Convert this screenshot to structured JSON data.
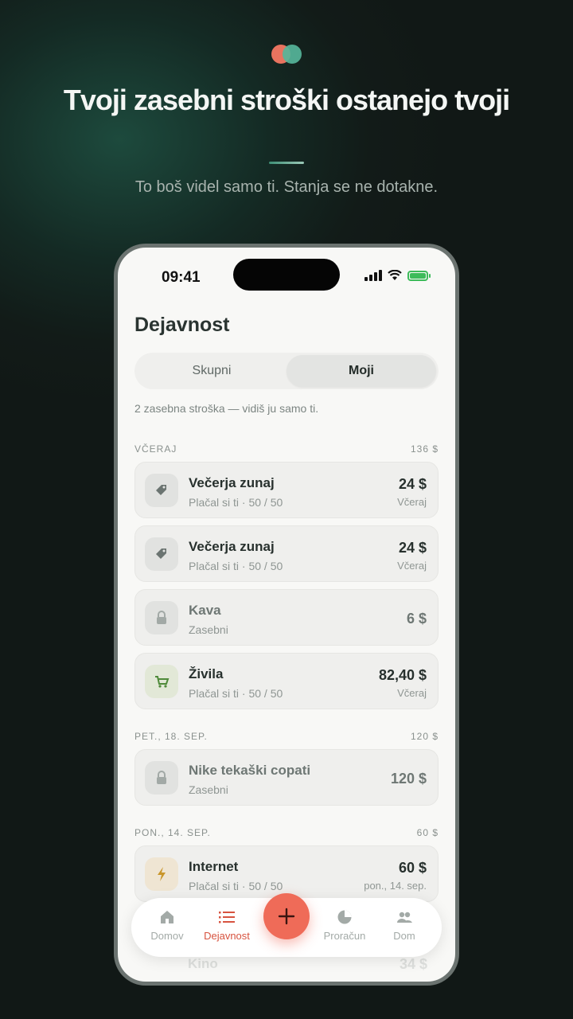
{
  "hero": {
    "headline": "Tvoji zasebni stroški ostanejo tvoji",
    "subtitle": "To boš videl samo ti. Stanja se ne dotakne."
  },
  "status_bar": {
    "time": "09:41"
  },
  "screen": {
    "title": "Dejavnost",
    "segments": [
      {
        "label": "Skupni",
        "selected": false
      },
      {
        "label": "Moji",
        "selected": true
      }
    ],
    "note": "2 zasebna stroška — vidiš ju samo ti."
  },
  "sections": [
    {
      "label": "VČERAJ",
      "total": "136 $"
    },
    {
      "label": "PET., 18. SEP.",
      "total": "120 $"
    },
    {
      "label": "PON., 14. SEP.",
      "total": "60 $"
    }
  ],
  "expenses": [
    {
      "name": "Večerja zunaj",
      "meta": "Plačal si ti · 50 / 50",
      "amount": "24 $",
      "when": "Včeraj",
      "icon": "tag-icon"
    },
    {
      "name": "Večerja zunaj",
      "meta": "Plačal si ti · 50 / 50",
      "amount": "24 $",
      "when": "Včeraj",
      "icon": "tag-icon"
    },
    {
      "name": "Kava",
      "meta": "Zasebni",
      "amount": "6 $",
      "icon": "lock-icon"
    },
    {
      "name": "Živila",
      "meta": "Plačal si ti · 50 / 50",
      "amount": "82,40 $",
      "when": "Včeraj",
      "icon": "cart-icon"
    },
    {
      "name": "Nike tekaški copati",
      "meta": "Zasebni",
      "amount": "120 $",
      "icon": "lock-icon"
    },
    {
      "name": "Internet",
      "meta": "Plačal si ti · 50 / 50",
      "amount": "60 $",
      "when": "pon., 14. sep.",
      "icon": "bolt-icon"
    },
    {
      "name": "Kino",
      "amount": "34 $"
    }
  ],
  "tabbar": {
    "tabs": [
      {
        "label": "Domov",
        "icon": "home-icon"
      },
      {
        "label": "Dejavnost",
        "icon": "list-icon",
        "active": true
      },
      {
        "label": "Proračun",
        "icon": "pie-chart-icon"
      },
      {
        "label": "Dom",
        "icon": "people-icon"
      }
    ]
  },
  "colors": {
    "accent": "#ef6b58",
    "active_tab": "#d7533f",
    "background": "#121b18"
  }
}
